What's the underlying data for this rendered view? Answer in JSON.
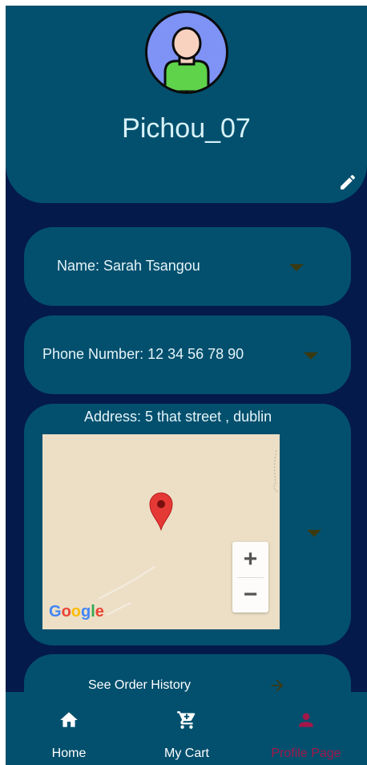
{
  "profile": {
    "username": "Pichou_07",
    "avatar_icon": "user-avatar-icon",
    "edit_icon": "pencil-icon"
  },
  "fields": {
    "name": "Name: Sarah  Tsangou",
    "phone": "Phone Number: 12 34 56 78 90",
    "address": "Address: 5 that street , dublin"
  },
  "map": {
    "zoom_in": "+",
    "zoom_out": "−",
    "attribution": [
      "G",
      "o",
      "o",
      "g",
      "l",
      "e"
    ],
    "attribution_colors": [
      "#4285F4",
      "#EA4335",
      "#FBBC05",
      "#4285F4",
      "#34A853",
      "#EA4335"
    ],
    "marker_color": "#e53935"
  },
  "order_history": {
    "label": "See Order History",
    "arrow_icon": "arrow-right-icon"
  },
  "nav": {
    "items": [
      {
        "label": "Home",
        "icon": "home-icon"
      },
      {
        "label": "My Cart",
        "icon": "cart-icon"
      },
      {
        "label": "Profile Page",
        "icon": "person-icon",
        "active": true
      }
    ],
    "active_color": "#a3174a",
    "inactive_color": "#ffffff"
  },
  "colors": {
    "background": "#041a4a",
    "card": "#03506e",
    "dropdown_arrow": "#3a3a12"
  }
}
